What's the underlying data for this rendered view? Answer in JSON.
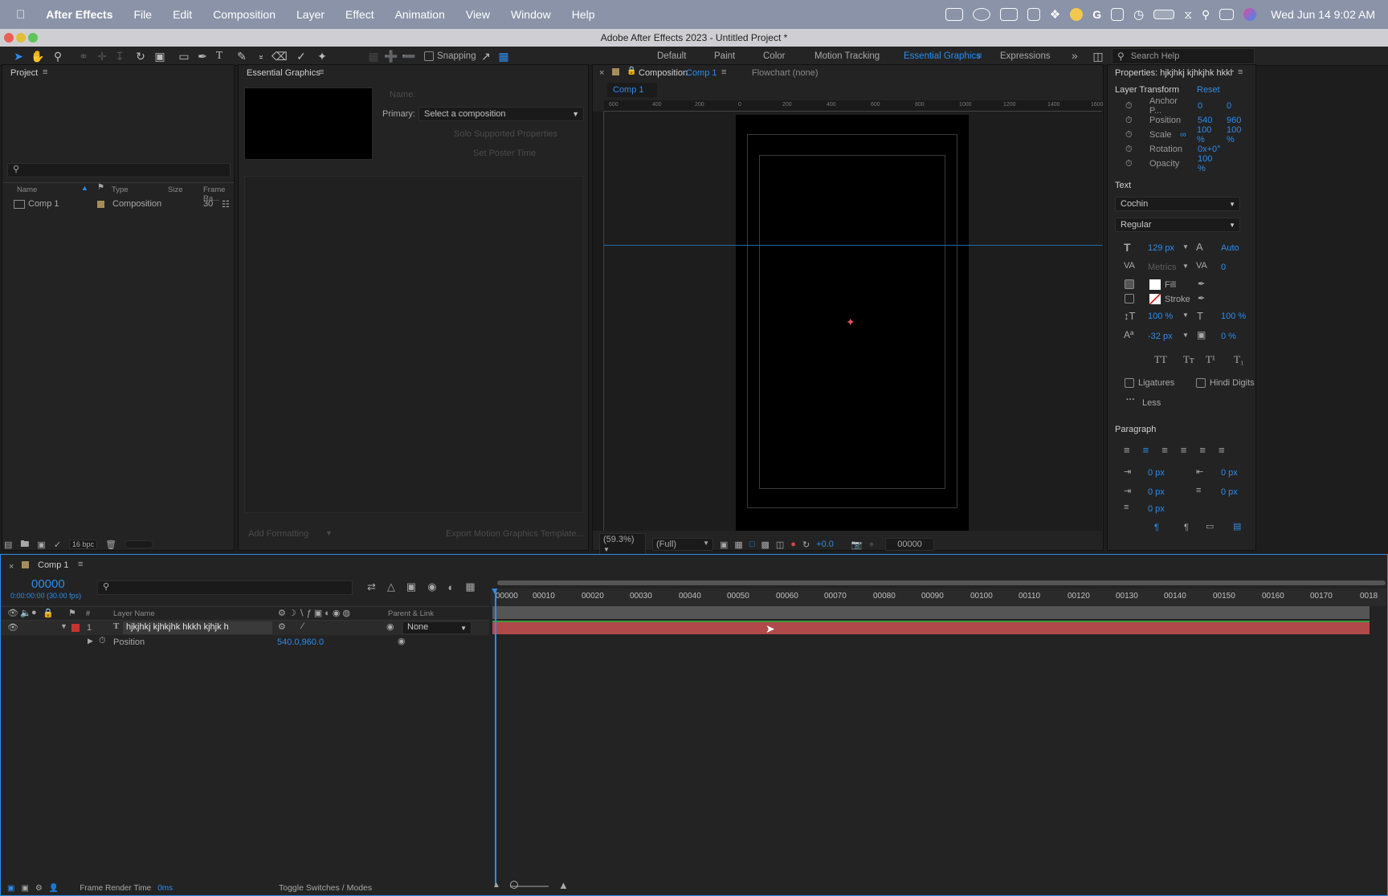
{
  "menubar": {
    "app": "After Effects",
    "items": [
      "File",
      "Edit",
      "Composition",
      "Layer",
      "Effect",
      "Animation",
      "View",
      "Window",
      "Help"
    ],
    "clock": "Wed Jun 14  9:02 AM",
    "icons": [
      "apple-icon",
      "screen-share-icon",
      "creative-cloud-icon",
      "video-icon",
      "drive-icon",
      "dropbox-icon",
      "s-icon",
      "g-icon",
      "calendar-icon",
      "clock-icon",
      "battery-icon",
      "wifi-icon",
      "search-icon",
      "control-center-icon",
      "siri-icon"
    ]
  },
  "window": {
    "title": "Adobe After Effects 2023 - Untitled Project *"
  },
  "toolbar": {
    "snapping": "Snapping",
    "workspaces": [
      "Default",
      "Paint",
      "Color",
      "Motion Tracking",
      "Essential Graphics",
      "Expressions"
    ],
    "active_workspace": "Essential Graphics",
    "search_placeholder": "Search Help"
  },
  "project": {
    "title": "Project",
    "columns": [
      "Name",
      "Type",
      "Size",
      "Frame Ra..."
    ],
    "items": [
      {
        "name": "Comp 1",
        "type": "Composition",
        "frame_rate": "30"
      }
    ],
    "bpc": "16 bpc"
  },
  "essential": {
    "title": "Essential Graphics",
    "name_label": "Name:",
    "primary_label": "Primary:",
    "primary_value": "Select a composition",
    "solo": "Solo Supported Properties",
    "poster": "Set Poster Time",
    "add_formatting": "Add Formatting",
    "export": "Export Motion Graphics Template..."
  },
  "composition": {
    "tab_prefix": "Composition",
    "tab_name": "Comp 1",
    "flowchart": "Flowchart (none)",
    "subtab": "Comp 1",
    "ruler": [
      "600",
      "400",
      "200",
      "0",
      "200",
      "400",
      "600",
      "800",
      "1000",
      "1200",
      "1400",
      "1600"
    ],
    "zoom": "(59.3%)",
    "quality": "(Full)",
    "exposure": "+0.0",
    "timecode": "00000"
  },
  "properties": {
    "title": "Properties: hjkjhkj kjhkjhk hkkh k",
    "layer_transform": "Layer Transform",
    "reset": "Reset",
    "transform": [
      {
        "label": "Anchor P...",
        "v1": "0",
        "v2": "0"
      },
      {
        "label": "Position",
        "v1": "540",
        "v2": "960"
      },
      {
        "label": "Scale",
        "v1": "100 %",
        "v2": "100 %"
      },
      {
        "label": "Rotation",
        "v1": "0x+0°",
        "v2": ""
      },
      {
        "label": "Opacity",
        "v1": "100 %",
        "v2": ""
      }
    ],
    "text_label": "Text",
    "font": "Cochin",
    "style": "Regular",
    "font_size": "129 px",
    "leading": "Auto",
    "kerning": "Metrics",
    "tracking": "0",
    "fill": "Fill",
    "stroke": "Stroke",
    "vscale": "100 %",
    "hscale": "100 %",
    "baseline": "-32 px",
    "tsume": "0 %",
    "caps": [
      "TT",
      "Tт",
      "T¹",
      "T₁"
    ],
    "ligatures": "Ligatures",
    "hindi": "Hindi Digits",
    "less": "Less",
    "paragraph": "Paragraph",
    "para_vals": [
      "0 px",
      "0 px",
      "0 px",
      "0 px",
      "0 px"
    ]
  },
  "timeline": {
    "tab": "Comp 1",
    "timecode": "00000",
    "sub_timecode": "0:00:00:00 (30.00 fps)",
    "col_layer_name": "Layer Name",
    "col_parent": "Parent & Link",
    "ticks": [
      "00000",
      "00010",
      "00020",
      "00030",
      "00040",
      "00050",
      "00060",
      "00070",
      "00080",
      "00090",
      "00100",
      "00110",
      "00120",
      "00130",
      "00140",
      "00150",
      "00160",
      "00170",
      "0018"
    ],
    "layer": {
      "num": "1",
      "name": "hjkjhkj kjhkjhk hkkh kjhjk  h",
      "parent": "None"
    },
    "prop": {
      "name": "Position",
      "value": "540.0,960.0"
    },
    "render_label": "Frame Render Time",
    "render_value": "0ms",
    "toggle": "Toggle Switches / Modes"
  },
  "colors": {
    "accent": "#2d8ceb",
    "layer_bar": "#b04a4a",
    "label_red": "#c83232",
    "bg": "#1d1d1d"
  }
}
